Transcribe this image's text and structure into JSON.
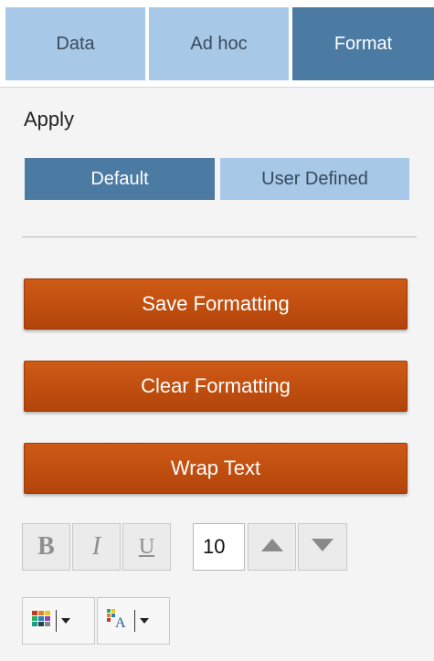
{
  "tabs": [
    {
      "label": "Data"
    },
    {
      "label": "Ad hoc"
    },
    {
      "label": "Format"
    }
  ],
  "active_tab": "Format",
  "apply": {
    "label": "Apply",
    "options": [
      {
        "label": "Default",
        "selected": true
      },
      {
        "label": "User Defined",
        "selected": false
      }
    ]
  },
  "actions": {
    "save": "Save Formatting",
    "clear": "Clear Formatting",
    "wrap": "Wrap Text"
  },
  "toolbar": {
    "bold": "B",
    "italic": "I",
    "underline": "U",
    "font_size": "10",
    "increase_icon": "triangle-up-icon",
    "decrease_icon": "triangle-down-icon",
    "fill_color_icon": "color-grid-icon",
    "font_color_icon": "font-color-icon"
  },
  "colors": {
    "tab_active": "#4b7aa3",
    "tab_inactive": "#a8c8e8",
    "action_button": "#c14d10"
  }
}
